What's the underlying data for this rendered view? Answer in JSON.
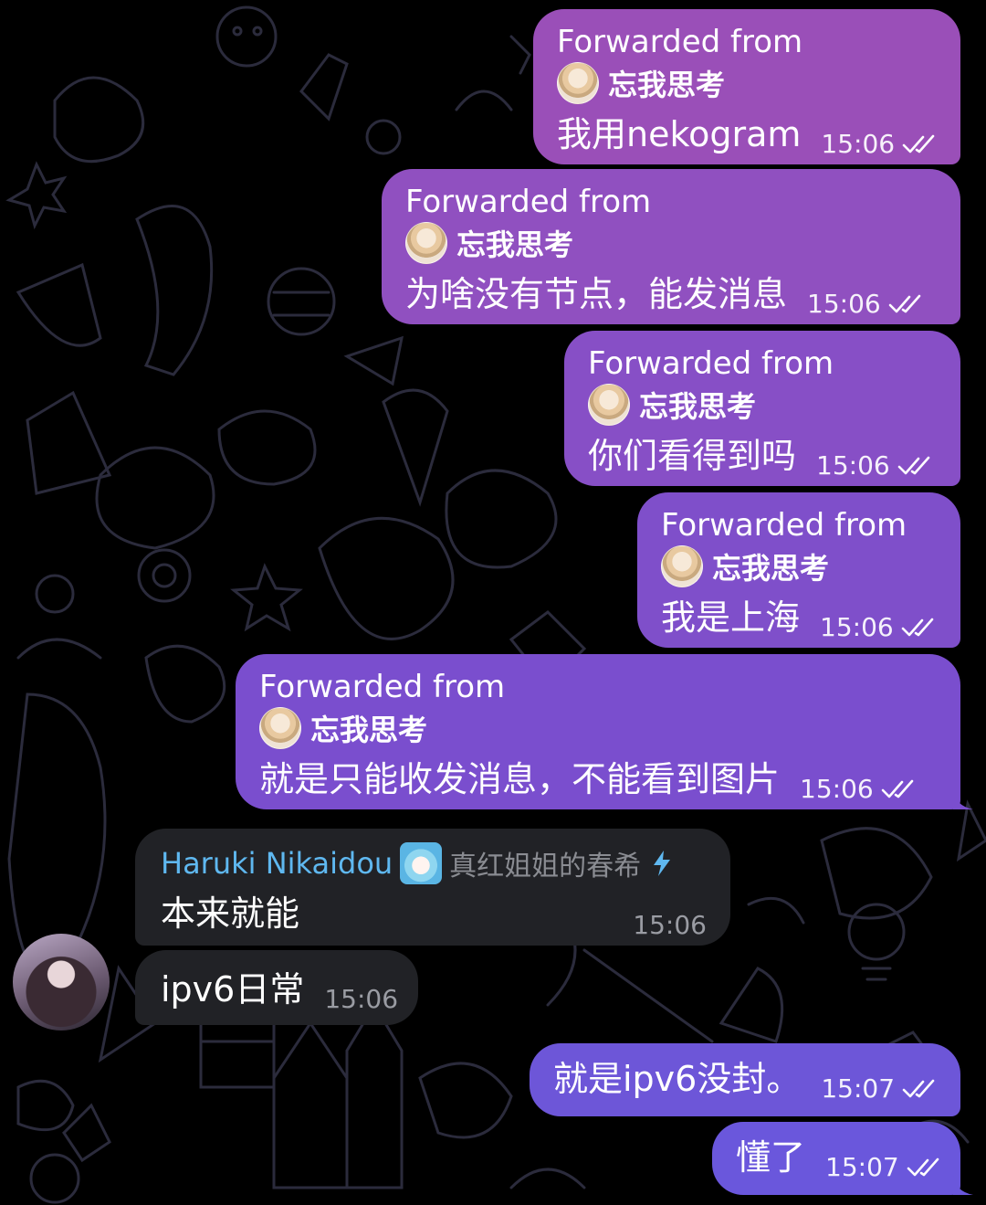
{
  "messages": {
    "fwd1": {
      "forward_label": "Forwarded from",
      "forward_name": "忘我思考",
      "text": "我用nekogram",
      "time": "15:06"
    },
    "fwd2": {
      "forward_label": "Forwarded from",
      "forward_name": "忘我思考",
      "text": "为啥没有节点，能发消息",
      "time": "15:06"
    },
    "fwd3": {
      "forward_label": "Forwarded from",
      "forward_name": "忘我思考",
      "text": "你们看得到吗",
      "time": "15:06"
    },
    "fwd4": {
      "forward_label": "Forwarded from",
      "forward_name": "忘我思考",
      "text": "我是上海",
      "time": "15:06"
    },
    "fwd5": {
      "forward_label": "Forwarded from",
      "forward_name": "忘我思考",
      "text": "就是只能收发消息，不能看到图片",
      "time": "15:06"
    },
    "in1": {
      "sender": "Haruki Nikaidou",
      "sender_title": "真红姐姐的春希",
      "text": "本来就能",
      "time": "15:06"
    },
    "in2": {
      "text": "ipv6日常",
      "time": "15:06"
    },
    "out1": {
      "text": "就是ipv6没封。",
      "time": "15:07"
    },
    "out2": {
      "text": "懂了",
      "time": "15:07"
    }
  },
  "colors": {
    "outgoing_top": "#9a4fb8",
    "outgoing_bottom": "#6f55d8",
    "incoming": "#212226",
    "sender_name": "#5fb8f0",
    "background": "#000000",
    "doodle": "#2a2a3a"
  },
  "icons": {
    "read_status": "double-check-icon",
    "admin_badge": "lightning-bolt-icon"
  }
}
